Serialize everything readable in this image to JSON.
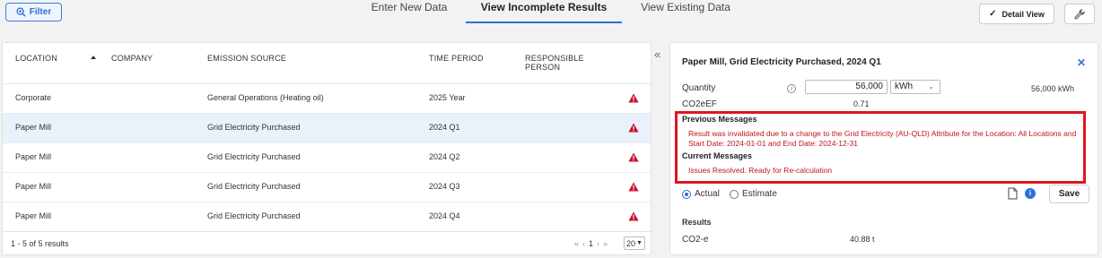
{
  "toolbar": {
    "filter_label": "Filter",
    "tabs": [
      {
        "label": "Enter New Data"
      },
      {
        "label": "View Incomplete Results"
      },
      {
        "label": "View Existing Data"
      }
    ],
    "detail_view_label": "Detail View"
  },
  "table": {
    "headers": {
      "location": "LOCATION",
      "company": "COMPANY",
      "emission_source": "EMISSION SOURCE",
      "time_period": "TIME PERIOD",
      "responsible_person_1": "RESPONSIBLE",
      "responsible_person_2": "PERSON"
    },
    "rows": [
      {
        "location": "Corporate",
        "company": "",
        "emission_source": "General Operations (Heating oil)",
        "time_period": "2025 Year",
        "selected": false
      },
      {
        "location": "Paper Mill",
        "company": "",
        "emission_source": "Grid Electricity Purchased",
        "time_period": "2024 Q1",
        "selected": true
      },
      {
        "location": "Paper Mill",
        "company": "",
        "emission_source": "Grid Electricity Purchased",
        "time_period": "2024 Q2",
        "selected": false
      },
      {
        "location": "Paper Mill",
        "company": "",
        "emission_source": "Grid Electricity Purchased",
        "time_period": "2024 Q3",
        "selected": false
      },
      {
        "location": "Paper Mill",
        "company": "",
        "emission_source": "Grid Electricity Purchased",
        "time_period": "2024 Q4",
        "selected": false
      }
    ],
    "results_count": "1 - 5 of 5 results",
    "pager": {
      "first": "«",
      "prev": "‹",
      "page": "1",
      "next": "›",
      "last": "»",
      "page_size": "20"
    }
  },
  "detail": {
    "title": "Paper Mill, Grid Electricity Purchased, 2024 Q1",
    "quantity_label": "Quantity",
    "quantity_value": "56,000",
    "unit": "kWh",
    "quantity_right": "56,000  kWh",
    "co2eef_label": "CO2eEF",
    "co2eef_value": "0.71",
    "previous_messages_label": "Previous Messages",
    "previous_message_line1": "Result was invalidated due to a change to the Grid Electricity (AU-QLD) Attribute for the Location: All Locations and",
    "previous_message_line2": "Start Date: 2024-01-01 and End Date: 2024-12-31",
    "current_messages_label": "Current Messages",
    "current_message": "Issues Resolved. Ready for Re-calculation",
    "actual_label": "Actual",
    "estimate_label": "Estimate",
    "save_label": "Save",
    "results_label": "Results",
    "co2e_label": "CO2-e",
    "co2e_value": "40.88 t"
  },
  "colors": {
    "accent": "#2f6fd6",
    "warning": "#c8102e",
    "highlight_border": "#e0141e"
  }
}
